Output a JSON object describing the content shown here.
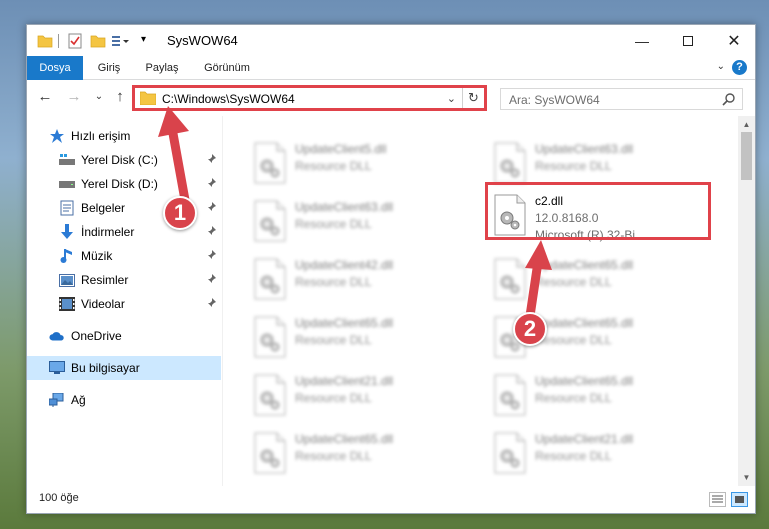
{
  "window": {
    "title": "SysWOW64"
  },
  "ribbon": {
    "tabs": [
      {
        "label": "Dosya",
        "active": true
      },
      {
        "label": "Giriş",
        "active": false
      },
      {
        "label": "Paylaş",
        "active": false
      },
      {
        "label": "Görünüm",
        "active": false
      }
    ]
  },
  "nav": {
    "address": "C:\\Windows\\SysWOW64",
    "search_placeholder": "Ara: SysWOW64"
  },
  "sidebar": {
    "items": [
      {
        "label": "Hızlı erişim",
        "icon": "star-icon"
      },
      {
        "label": "Yerel Disk (C:)",
        "icon": "drive-c-icon",
        "pinned": true
      },
      {
        "label": "Yerel Disk (D:)",
        "icon": "drive-d-icon",
        "pinned": true
      },
      {
        "label": "Belgeler",
        "icon": "documents-icon",
        "pinned": true
      },
      {
        "label": "İndirmeler",
        "icon": "downloads-icon",
        "pinned": true
      },
      {
        "label": "Müzik",
        "icon": "music-icon",
        "pinned": true
      },
      {
        "label": "Resimler",
        "icon": "pictures-icon",
        "pinned": true
      },
      {
        "label": "Videolar",
        "icon": "videos-icon",
        "pinned": true
      },
      {
        "label": "OneDrive",
        "icon": "onedrive-icon"
      },
      {
        "label": "Bu bilgisayar",
        "icon": "this-pc-icon",
        "selected": true
      },
      {
        "label": "Ağ",
        "icon": "network-icon"
      }
    ]
  },
  "files": [
    {
      "name": "UpdateClient5.dll",
      "desc": "Resource DLL",
      "col": 0,
      "row": 0
    },
    {
      "name": "UpdateClient63.dll",
      "desc": "Resource DLL",
      "col": 1,
      "row": 0
    },
    {
      "name": "UpdateClient63.dll",
      "desc": "Resource DLL",
      "col": 0,
      "row": 1
    },
    {
      "name": "c2.dll",
      "desc": "12.0.8168.0",
      "desc2": "Microsoft (R) 32-Bi...",
      "col": 1,
      "row": 1,
      "highlight": true
    },
    {
      "name": "UpdateClient42.dll",
      "desc": "Resource DLL",
      "col": 0,
      "row": 2
    },
    {
      "name": "UpdateClient65.dll",
      "desc": "Resource DLL",
      "col": 1,
      "row": 2
    },
    {
      "name": "UpdateClient65.dll",
      "desc": "Resource DLL",
      "col": 0,
      "row": 3
    },
    {
      "name": "UpdateClient65.dll",
      "desc": "Resource DLL",
      "col": 1,
      "row": 3
    },
    {
      "name": "UpdateClient21.dll",
      "desc": "Resource DLL",
      "col": 0,
      "row": 4
    },
    {
      "name": "UpdateClient65.dll",
      "desc": "Resource DLL",
      "col": 1,
      "row": 4
    },
    {
      "name": "UpdateClient65.dll",
      "desc": "Resource DLL",
      "col": 0,
      "row": 5
    },
    {
      "name": "UpdateClient21.dll",
      "desc": "Resource DLL",
      "col": 1,
      "row": 5
    }
  ],
  "status": {
    "item_count": "100 öğe"
  },
  "annotations": {
    "step1": "1",
    "step2": "2",
    "color": "#d9434b"
  },
  "colors": {
    "accent": "#1979ca",
    "selection": "#cce8ff",
    "highlight": "#e0424a"
  }
}
